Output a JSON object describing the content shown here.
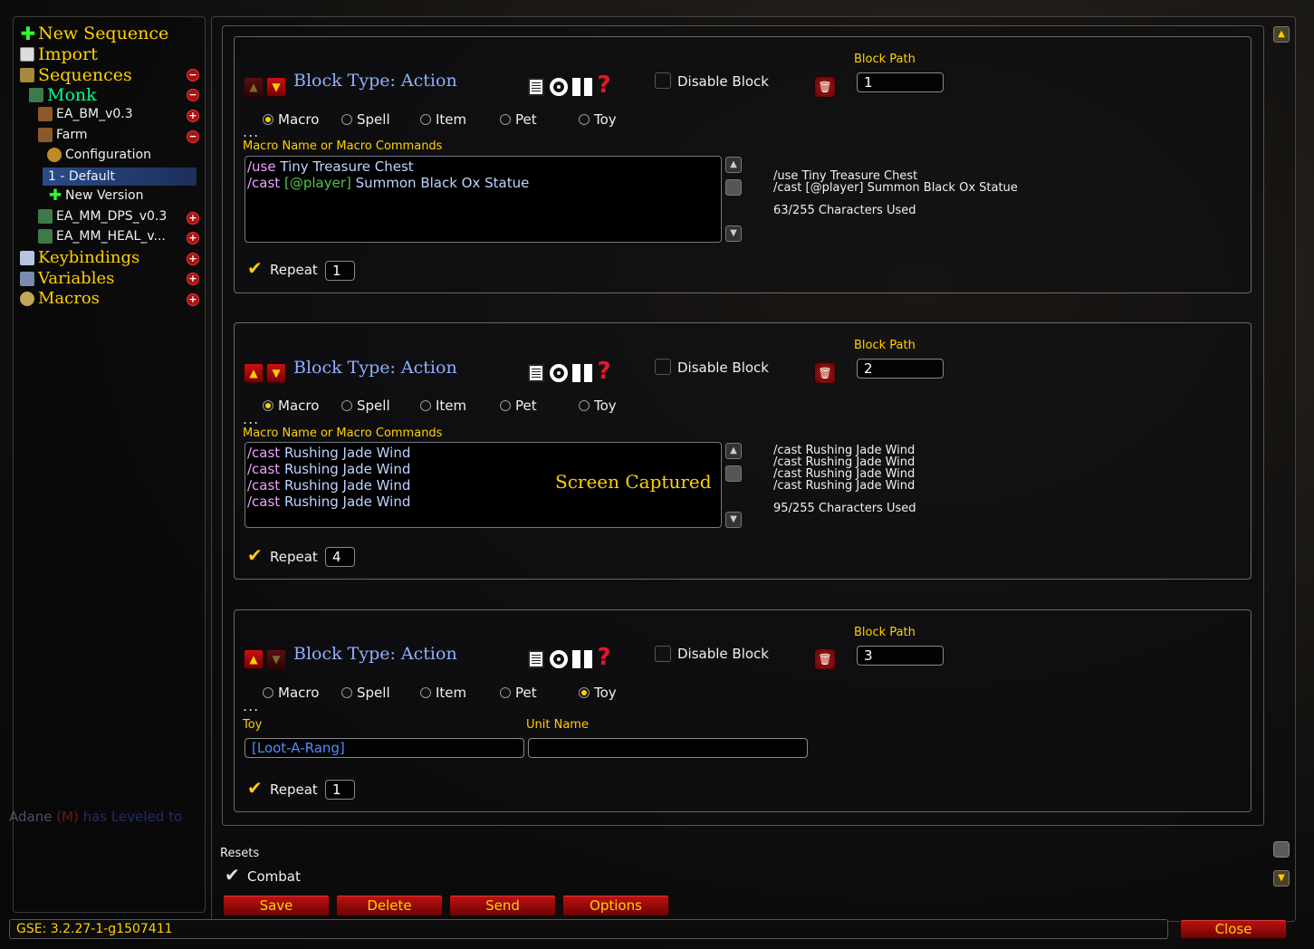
{
  "tree": {
    "new_sequence": "New Sequence",
    "import": "Import",
    "sequences": "Sequences",
    "monk": "Monk",
    "ea_bm": "EA_BM_v0.3",
    "farm": "Farm",
    "configuration": "Configuration",
    "default": "1 - Default",
    "new_version": "New Version",
    "ea_mm_dps": "EA_MM_DPS_v0.3",
    "ea_mm_heal": "EA_MM_HEAL_v...",
    "keybindings": "Keybindings",
    "variables": "Variables",
    "macros": "Macros"
  },
  "common": {
    "block_type": "Block Type: Action",
    "disable_block": "Disable Block",
    "block_path": "Block Path",
    "macro_cmd_label": "Macro Name or Macro Commands",
    "repeat": "Repeat",
    "radio_macro": "Macro",
    "radio_spell": "Spell",
    "radio_item": "Item",
    "radio_pet": "Pet",
    "radio_toy": "Toy",
    "ellipsis": "...",
    "toy_label": "Toy",
    "unit_name_label": "Unit Name"
  },
  "blocks": [
    {
      "path": "1",
      "selected_type": "Macro",
      "code": [
        {
          "cmd": "/use",
          "cond": "",
          "arg": "Tiny Treasure Chest"
        },
        {
          "cmd": "/cast",
          "cond": "[@player]",
          "arg": "Summon Black Ox Statue"
        }
      ],
      "preview": [
        "/use Tiny Treasure Chest",
        "/cast [@player] Summon Black Ox Statue"
      ],
      "chars_used": "63/255 Characters Used",
      "repeat": "1"
    },
    {
      "path": "2",
      "selected_type": "Macro",
      "code": [
        {
          "cmd": "/cast",
          "cond": "",
          "arg": "Rushing Jade Wind"
        },
        {
          "cmd": "/cast",
          "cond": "",
          "arg": "Rushing Jade Wind"
        },
        {
          "cmd": "/cast",
          "cond": "",
          "arg": "Rushing Jade Wind"
        },
        {
          "cmd": "/cast",
          "cond": "",
          "arg": "Rushing Jade Wind"
        }
      ],
      "overlay": "Screen Captured",
      "preview": [
        "/cast Rushing Jade Wind",
        "/cast Rushing Jade Wind",
        "/cast Rushing Jade Wind",
        "/cast Rushing Jade Wind"
      ],
      "chars_used": "95/255 Characters Used",
      "repeat": "4"
    },
    {
      "path": "3",
      "selected_type": "Toy",
      "toy_value": "[Loot-A-Rang]",
      "unit_name_value": "",
      "repeat": "1"
    }
  ],
  "resets": {
    "label": "Resets",
    "combat": "Combat"
  },
  "buttons": {
    "save": "Save",
    "delete": "Delete",
    "send": "Send",
    "options": "Options",
    "close": "Close"
  },
  "status": {
    "version": "GSE: 3.2.27-1-g1507411"
  },
  "chat": {
    "name": "Adane",
    "tag": "(M)",
    "text": "has Leveled to"
  },
  "colors": {
    "gold": "#ffd100",
    "monk": "#00ff98",
    "block_type": "#8fb0ff",
    "macro_cmd": "#f0a3ff",
    "condition": "#52c34a",
    "link": "#4f8bff",
    "button_red": "#c41010"
  }
}
